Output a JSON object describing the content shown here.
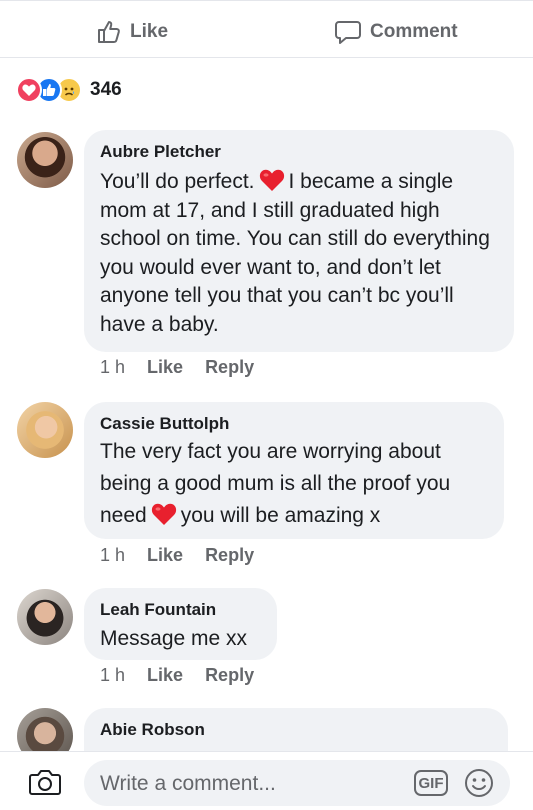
{
  "actions": {
    "like_label": "Like",
    "comment_label": "Comment"
  },
  "reactions": {
    "count": "346",
    "types": [
      "love",
      "like",
      "sad"
    ]
  },
  "comments": [
    {
      "name": "Aubre Pletcher",
      "text_before": "You’ll do perfect.",
      "text_after": "I became a single mom at 17, and I still graduated high school on time. You can still do everything you would ever want to, and don’t let anyone tell you that you can’t bc you’ll have a baby.",
      "time": "1 h",
      "like": "Like",
      "reply": "Reply"
    },
    {
      "name": "Cassie Buttolph",
      "text_before": "The very fact you are worrying about being a good mum is all the proof you need",
      "text_after": "you will be amazing x",
      "time": "1 h",
      "like": "Like",
      "reply": "Reply"
    },
    {
      "name": "Leah Fountain",
      "text": "Message me xx",
      "time": "1 h",
      "like": "Like",
      "reply": "Reply"
    },
    {
      "name": "Abie Robson"
    }
  ],
  "composer": {
    "placeholder": "Write a comment...",
    "gif_label": "GIF"
  },
  "colors": {
    "bubble": "#f0f2f5",
    "meta": "#65676b",
    "heart": "#e8202e",
    "like_blue": "#1877f2"
  }
}
